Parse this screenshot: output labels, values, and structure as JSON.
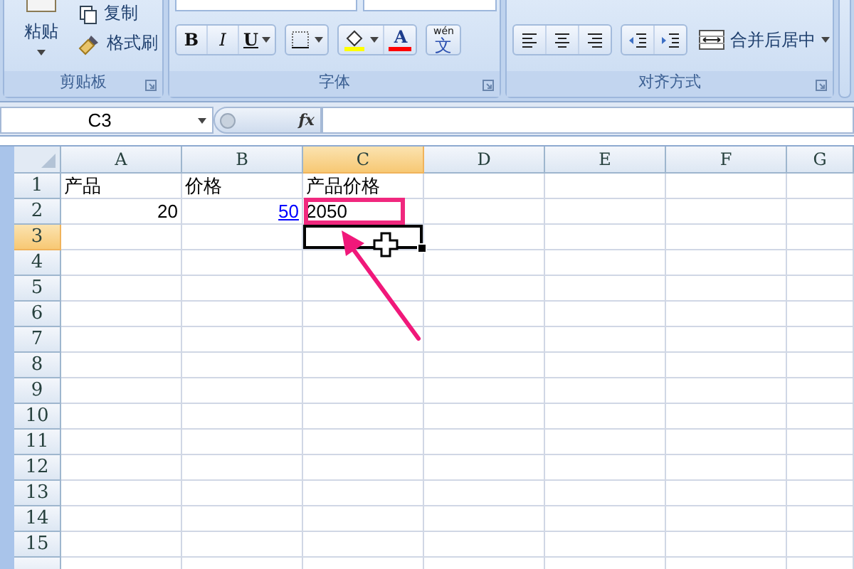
{
  "ribbon": {
    "clipboard": {
      "label": "剪贴板",
      "paste": "粘贴",
      "copy": "复制",
      "format_painter": "格式刷"
    },
    "font": {
      "label": "字体",
      "buttons": [
        {
          "kind": "bold",
          "text": "B"
        },
        {
          "kind": "italic",
          "text": "I"
        },
        {
          "kind": "underline",
          "text": "U"
        },
        {
          "kind": "border"
        },
        {
          "kind": "fill"
        },
        {
          "kind": "font_color",
          "text": "A"
        },
        {
          "kind": "phonetic",
          "ruby": "wén",
          "text": "文"
        }
      ]
    },
    "alignment": {
      "label": "对齐方式",
      "buttons": [
        {
          "kind": "align_left"
        },
        {
          "kind": "align_center"
        },
        {
          "kind": "align_right"
        },
        {
          "kind": "indent_decrease"
        },
        {
          "kind": "indent_increase"
        }
      ],
      "merge": "合并后居中"
    }
  },
  "formula_bar": {
    "name_box": "C3",
    "fx": "fx"
  },
  "sheet": {
    "columns": [
      {
        "label": "A",
        "selected": false
      },
      {
        "label": "B",
        "selected": false
      },
      {
        "label": "C",
        "selected": true
      },
      {
        "label": "D",
        "selected": false
      },
      {
        "label": "E",
        "selected": false
      },
      {
        "label": "F",
        "selected": false
      },
      {
        "label": "G",
        "selected": false
      }
    ],
    "rows": [
      {
        "label": "1",
        "selected": false,
        "cells": [
          {
            "kind": "text",
            "text": "产品",
            "selected": false
          },
          {
            "kind": "text",
            "text": "价格",
            "selected": false
          },
          {
            "kind": "text",
            "text": "产品价格",
            "selected": false
          },
          null,
          null,
          null,
          null
        ]
      },
      {
        "label": "2",
        "selected": false,
        "cells": [
          {
            "kind": "number",
            "text": "20",
            "selected": false
          },
          {
            "kind": "link",
            "text": "50",
            "selected": false
          },
          {
            "kind": "text",
            "text": "2050",
            "selected": false
          },
          null,
          null,
          null,
          null
        ]
      },
      {
        "label": "3",
        "selected": true,
        "cells": [
          null,
          null,
          {
            "kind": "empty",
            "selected": true
          },
          null,
          null,
          null,
          null
        ]
      },
      {
        "label": "4",
        "selected": false
      },
      {
        "label": "5",
        "selected": false
      },
      {
        "label": "6",
        "selected": false
      },
      {
        "label": "7",
        "selected": false
      },
      {
        "label": "8",
        "selected": false
      },
      {
        "label": "9",
        "selected": false
      },
      {
        "label": "10",
        "selected": false
      },
      {
        "label": "11",
        "selected": false
      },
      {
        "label": "12",
        "selected": false
      },
      {
        "label": "13",
        "selected": false
      },
      {
        "label": "14",
        "selected": false
      },
      {
        "label": "15",
        "selected": false
      }
    ]
  }
}
